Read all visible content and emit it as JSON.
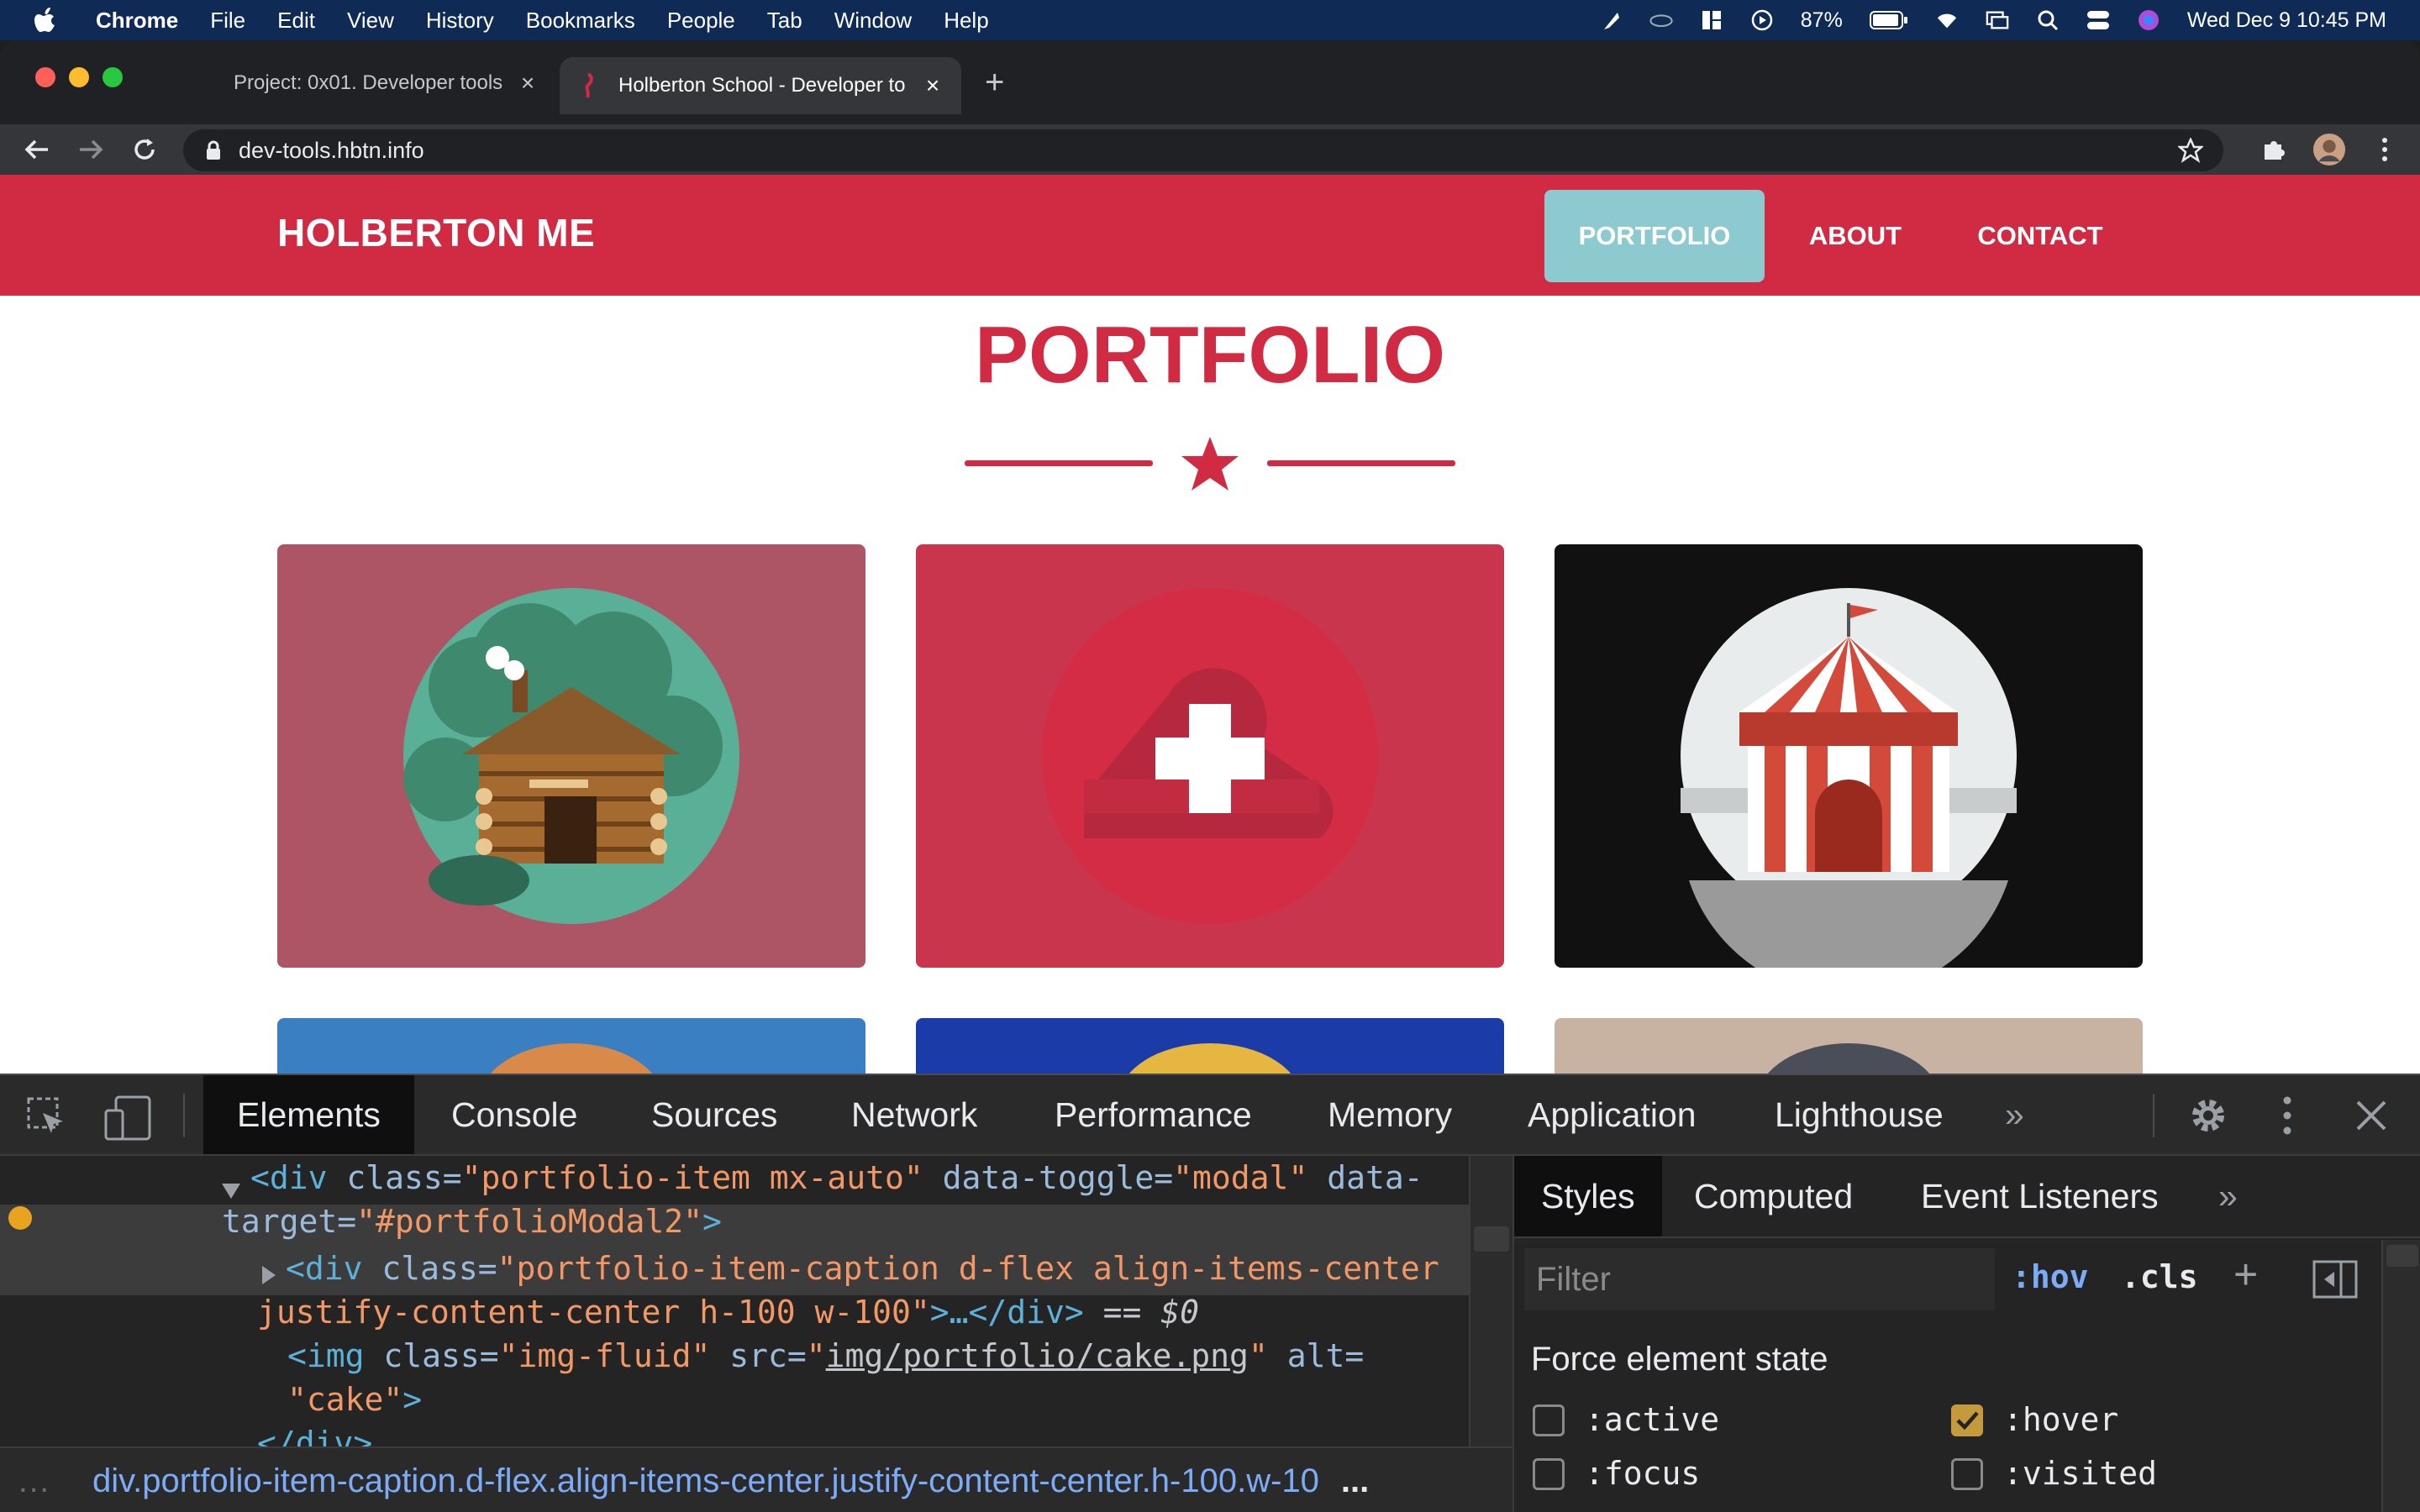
{
  "menubar": {
    "app": "Chrome",
    "items": [
      "File",
      "Edit",
      "View",
      "History",
      "Bookmarks",
      "People",
      "Tab",
      "Window",
      "Help"
    ],
    "battery": "87%",
    "datetime": "Wed Dec 9  10:45 PM"
  },
  "browser": {
    "tabs": [
      {
        "label": "Project: 0x01. Developer tools |"
      },
      {
        "label": "Holberton School - Developer to"
      }
    ],
    "url": "dev-tools.hbtn.info"
  },
  "site": {
    "brand": "HOLBERTON ME",
    "nav": [
      "PORTFOLIO",
      "ABOUT",
      "CONTACT"
    ],
    "active_nav": "PORTFOLIO",
    "section_title": "PORTFOLIO",
    "tiles": [
      {
        "name": "cabin",
        "bg": "#ad5565"
      },
      {
        "name": "cake-hover",
        "bg": "#c8354d"
      },
      {
        "name": "circus",
        "bg": "#111111"
      },
      {
        "name": "row2-1",
        "bg": "#3a7fc2"
      },
      {
        "name": "row2-2",
        "bg": "#1b3ba8"
      },
      {
        "name": "row2-3",
        "bg": "#c8b2a2"
      }
    ],
    "accent": "#d12b44",
    "hover_color": "#8dcad0"
  },
  "devtools": {
    "tabs": [
      "Elements",
      "Console",
      "Sources",
      "Network",
      "Performance",
      "Memory",
      "Application",
      "Lighthouse"
    ],
    "more": "»",
    "code": {
      "line1_tag_open": "<div",
      "line1_attr1": " class=",
      "line1_val1": "\"portfolio-item mx-auto\"",
      "line1_attr2": " data-toggle=",
      "line1_val2": "\"modal\"",
      "line1_attr3": " data-",
      "line2_attr": "target=",
      "line2_val": "\"#portfolioModal2\"",
      "line2_close": ">",
      "line3_tag_open": "<div",
      "line3_attr": " class=",
      "line3_val": "\"portfolio-item-caption d-flex align-items-center",
      "line4_val": "justify-content-center h-100 w-100\"",
      "line4_rest": ">…</div>",
      "line4_eq": " == $0",
      "line5_tag": "<img",
      "line5_attr1": " class=",
      "line5_val1": "\"img-fluid\"",
      "line5_attr2": " src=",
      "line5_val2a": "\"",
      "line5_link": "img/portfolio/cake.png",
      "line5_val2b": "\"",
      "line5_attr3": " alt=",
      "line6_val": "\"cake\"",
      "line6_close": ">",
      "line7": "</div>"
    },
    "breadcrumb": "div.portfolio-item-caption.d-flex.align-items-center.justify-content-center.h-100.w-10",
    "breadcrumb_more": "...",
    "styles_tabs": [
      "Styles",
      "Computed",
      "Event Listeners"
    ],
    "styles_more": "»",
    "filter_placeholder": "Filter",
    "hov": ":hov",
    "cls": ".cls",
    "plus": "+",
    "force_state_title": "Force element state",
    "states": [
      {
        "label": ":active",
        "checked": false
      },
      {
        "label": ":hover",
        "checked": true
      },
      {
        "label": ":focus",
        "checked": false
      },
      {
        "label": ":visited",
        "checked": false
      }
    ]
  }
}
